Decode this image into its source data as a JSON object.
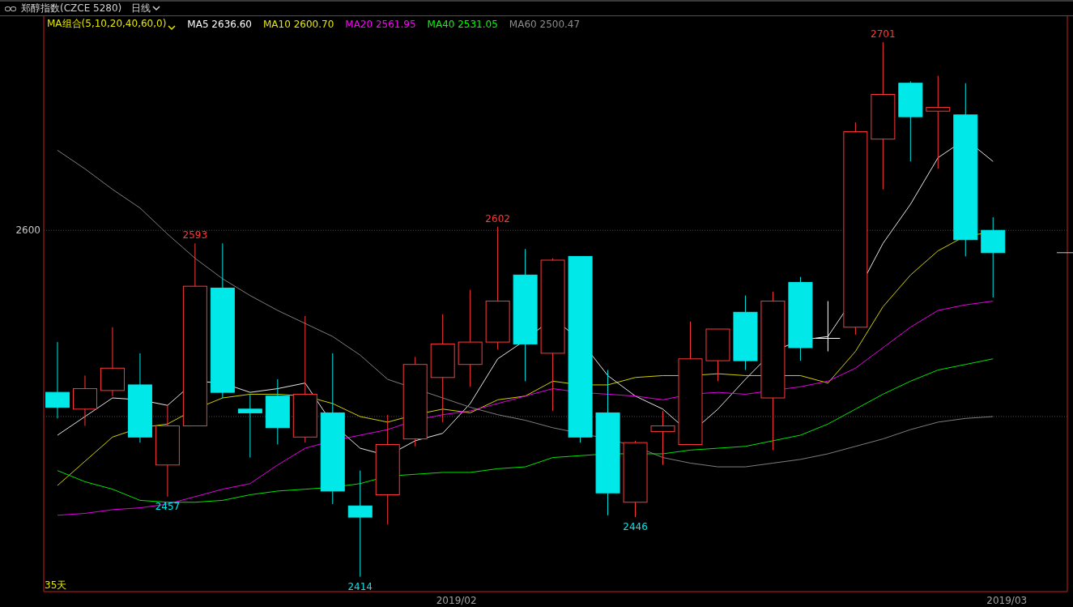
{
  "header": {
    "title": "郑醇指数(CZCE 5280)",
    "period": "日线"
  },
  "ma_legend": {
    "selector": "MA组合(5,10,20,40,60,0)",
    "items": [
      {
        "label": "MA5 2636.60",
        "color": "#ffffff"
      },
      {
        "label": "MA10 2600.70",
        "color": "#e6e600"
      },
      {
        "label": "MA20 2561.95",
        "color": "#ff00ff"
      },
      {
        "label": "MA40 2531.05",
        "color": "#00ff00"
      },
      {
        "label": "MA60 2500.47",
        "color": "#8c8c8c"
      }
    ]
  },
  "y_axis_labels": [
    "2600"
  ],
  "price_labels": [
    {
      "kind": "high",
      "text": "2593"
    },
    {
      "kind": "high",
      "text": "2602"
    },
    {
      "kind": "high",
      "text": "2701"
    },
    {
      "kind": "low",
      "text": "2457"
    },
    {
      "kind": "low",
      "text": "2414"
    },
    {
      "kind": "low",
      "text": "2446"
    }
  ],
  "day_count": "35天",
  "x_axis_labels": [
    "2019/02",
    "2019/03"
  ]
}
